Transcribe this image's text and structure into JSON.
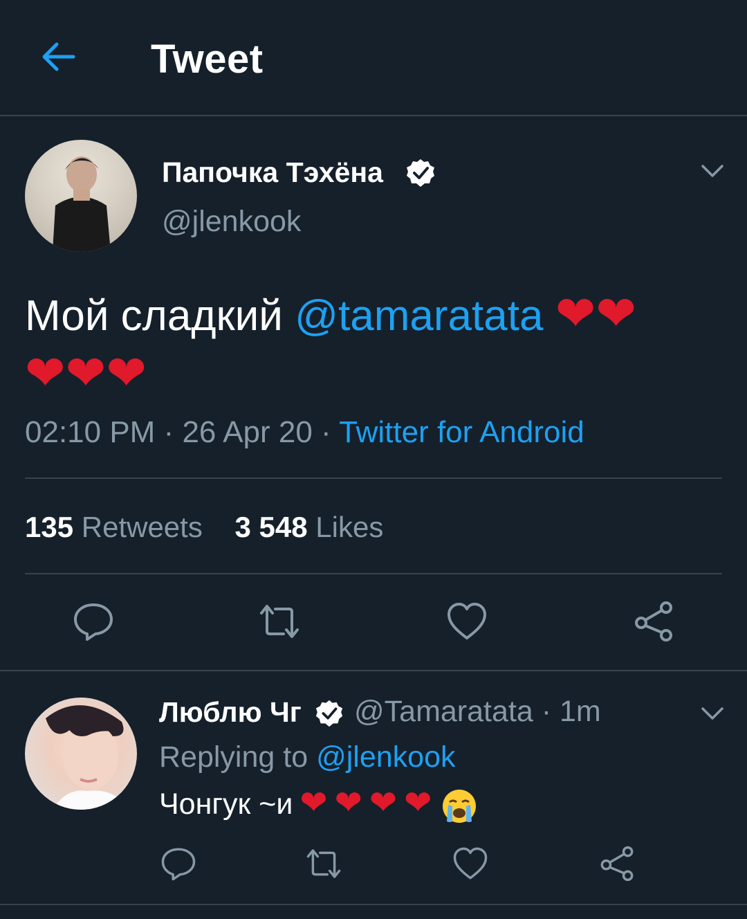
{
  "header": {
    "title": "Tweet",
    "back_icon": "back-arrow-icon"
  },
  "tweet": {
    "author_name": "Папочка Тэхёна",
    "author_handle": "@jlenkook",
    "verified_icon": "verified-badge-icon",
    "text_prefix": "Мой сладкий ",
    "text_mention": "@tamaratata",
    "hearts": [
      "❤",
      "❤",
      "❤",
      "❤",
      "❤"
    ],
    "time": "02:10 PM",
    "date": "26 Apr 20",
    "source": "Twitter for Android",
    "retweets_count": "135",
    "retweets_label": "Retweets",
    "likes_count": "3 548",
    "likes_label": "Likes",
    "actions": [
      "reply-icon",
      "retweet-icon",
      "like-icon",
      "share-icon"
    ]
  },
  "reply": {
    "author_name": "Люблю Чг",
    "author_handle": "@Tamaratata",
    "time": "1m",
    "replying_label": "Replying to",
    "replying_handle": "@jlenkook",
    "text": "Чонгук ~и",
    "hearts": [
      "❤",
      "❤",
      "❤",
      "❤"
    ],
    "emoji_icon": "crying-face-icon"
  },
  "colors": {
    "background": "#15202b",
    "accent": "#1da1f2",
    "secondary_text": "#8899a6",
    "heart": "#e0192b",
    "divider": "#38444d"
  }
}
